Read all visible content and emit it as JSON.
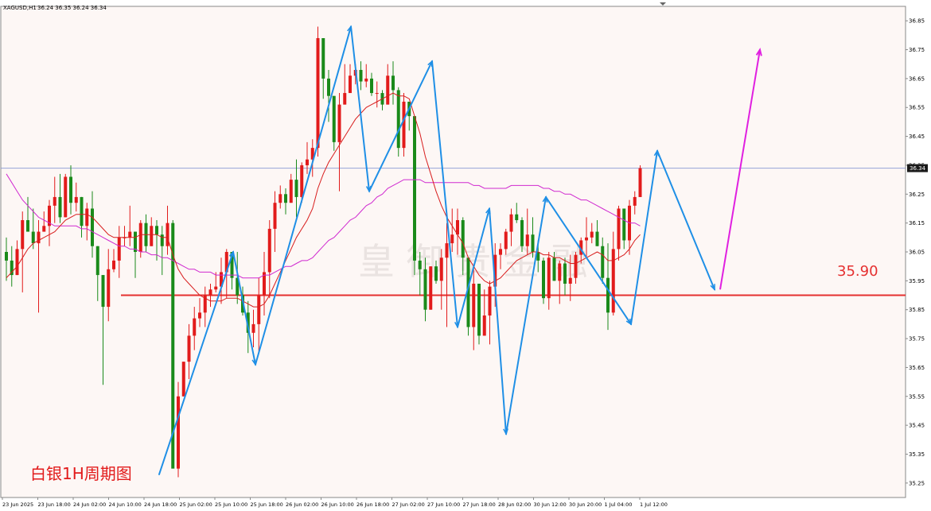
{
  "header": {
    "symbol": "XAGUSD,H1",
    "ohlc": "36.24 36.35 36.24 36.34"
  },
  "price_badge": "36.34",
  "level_label": "35.90",
  "chart_caption": "白银1H周期图",
  "watermark": "皇 御 贵 金 融",
  "colors": {
    "background": "#fdf7f5",
    "bull_candle": "#e21b1b",
    "bear_candle": "#1a8a1a",
    "ma_fast": "#d81e1e",
    "ma_slow": "#d02ad0",
    "wave_lines": "#1f8fe6",
    "projection": "#e020e0",
    "support_line": "#e53030",
    "current_price_line": "#7a8fd0"
  },
  "chart_data": {
    "type": "candlestick",
    "symbol": "XAGUSD",
    "timeframe": "H1",
    "title": "白银1H周期图",
    "ylim": [
      35.2,
      36.9
    ],
    "y_ticks": [
      35.25,
      35.35,
      35.45,
      35.55,
      35.65,
      35.75,
      35.85,
      35.95,
      36.05,
      36.15,
      36.25,
      36.35,
      36.45,
      36.55,
      36.65,
      36.75,
      36.85
    ],
    "x_ticks": [
      "23 Jun 2025",
      "23 Jun 18:00",
      "24 Jun 02:00",
      "24 Jun 10:00",
      "24 Jun 18:00",
      "25 Jun 02:00",
      "25 Jun 10:00",
      "25 Jun 18:00",
      "26 Jun 02:00",
      "26 Jun 10:00",
      "26 Jun 18:00",
      "27 Jun 02:00",
      "27 Jun 10:00",
      "27 Jun 18:00",
      "28 Jun 02:00",
      "30 Jun 12:00",
      "30 Jun 20:00",
      "1 Jul 04:00",
      "1 Jul 12:00"
    ],
    "current_price": 36.34,
    "support_level": 35.9,
    "wave_points": [
      35.28,
      36.05,
      35.66,
      36.83,
      36.26,
      36.71,
      35.79,
      36.2,
      35.42,
      36.24,
      35.8,
      36.4,
      35.92
    ],
    "projection_points": [
      35.92,
      36.75
    ],
    "series": [
      {
        "name": "OHLC",
        "points": [
          [
            36.05,
            36.1,
            35.95,
            36.02
          ],
          [
            36.02,
            36.07,
            35.93,
            35.97
          ],
          [
            35.97,
            36.09,
            35.97,
            36.06
          ],
          [
            36.06,
            36.19,
            35.91,
            36.16
          ],
          [
            36.16,
            36.24,
            36.12,
            36.12
          ],
          [
            36.12,
            36.2,
            36.06,
            36.08
          ],
          [
            36.08,
            36.16,
            35.84,
            36.12
          ],
          [
            36.12,
            36.19,
            36.12,
            36.14
          ],
          [
            36.14,
            36.23,
            36.07,
            36.21
          ],
          [
            36.21,
            36.31,
            36.15,
            36.24
          ],
          [
            36.24,
            36.32,
            36.15,
            36.17
          ],
          [
            36.17,
            36.32,
            36.17,
            36.31
          ],
          [
            36.31,
            36.35,
            36.18,
            36.22
          ],
          [
            36.22,
            36.29,
            36.19,
            36.24
          ],
          [
            36.24,
            36.24,
            36.1,
            36.14
          ],
          [
            36.14,
            36.22,
            36.09,
            36.2
          ],
          [
            36.2,
            36.26,
            36.03,
            36.07
          ],
          [
            36.07,
            36.07,
            35.88,
            35.97
          ],
          [
            35.97,
            35.97,
            35.59,
            35.86
          ],
          [
            35.86,
            36.06,
            35.81,
            35.99
          ],
          [
            35.99,
            36.06,
            35.98,
            36.02
          ],
          [
            36.02,
            36.14,
            35.96,
            36.1
          ],
          [
            36.1,
            36.14,
            36.07,
            36.1
          ],
          [
            36.1,
            36.21,
            36.07,
            36.12
          ],
          [
            36.12,
            36.12,
            35.96,
            36.05
          ],
          [
            36.05,
            36.16,
            36.03,
            36.15
          ],
          [
            36.15,
            36.18,
            36.05,
            36.07
          ],
          [
            36.07,
            36.17,
            36.07,
            36.14
          ],
          [
            36.14,
            36.16,
            36.02,
            36.11
          ],
          [
            36.11,
            36.14,
            35.97,
            36.07
          ],
          [
            36.07,
            36.21,
            36.04,
            36.15
          ],
          [
            36.15,
            36.16,
            35.59,
            35.3
          ],
          [
            35.3,
            35.6,
            35.27,
            35.55
          ],
          [
            35.55,
            35.67,
            35.55,
            35.67
          ],
          [
            35.67,
            35.8,
            35.61,
            35.76
          ],
          [
            35.76,
            35.86,
            35.71,
            35.82
          ],
          [
            35.82,
            35.89,
            35.79,
            35.84
          ],
          [
            35.84,
            35.93,
            35.79,
            35.9
          ],
          [
            35.9,
            35.94,
            35.86,
            35.92
          ],
          [
            35.92,
            35.98,
            35.91,
            35.93
          ],
          [
            35.93,
            36.03,
            35.87,
            35.98
          ],
          [
            35.98,
            36.06,
            35.89,
            36.05
          ],
          [
            36.05,
            36.05,
            35.92,
            35.96
          ],
          [
            35.96,
            36.05,
            35.87,
            35.9
          ],
          [
            35.9,
            35.93,
            35.83,
            35.84
          ],
          [
            35.84,
            35.88,
            35.7,
            35.77
          ],
          [
            35.77,
            35.85,
            35.72,
            35.8
          ],
          [
            35.8,
            35.96,
            35.7,
            35.9
          ],
          [
            35.9,
            36.05,
            35.83,
            35.98
          ],
          [
            35.98,
            36.16,
            35.89,
            36.13
          ],
          [
            36.13,
            36.26,
            36.05,
            36.22
          ],
          [
            36.22,
            36.28,
            36.2,
            36.25
          ],
          [
            36.25,
            36.27,
            36.18,
            36.22
          ],
          [
            36.22,
            36.32,
            36.22,
            36.3
          ],
          [
            36.3,
            36.37,
            36.17,
            36.24
          ],
          [
            36.24,
            36.36,
            36.22,
            36.35
          ],
          [
            36.35,
            36.43,
            36.32,
            36.37
          ],
          [
            36.37,
            36.44,
            36.31,
            36.41
          ],
          [
            36.41,
            36.83,
            36.38,
            36.79
          ],
          [
            36.79,
            36.79,
            36.58,
            36.65
          ],
          [
            36.65,
            36.68,
            36.5,
            36.59
          ],
          [
            36.59,
            36.59,
            36.4,
            36.43
          ],
          [
            36.43,
            36.6,
            36.26,
            36.56
          ],
          [
            36.56,
            36.7,
            36.56,
            36.6
          ],
          [
            36.6,
            36.7,
            36.6,
            36.66
          ],
          [
            36.66,
            36.7,
            36.63,
            36.68
          ],
          [
            36.68,
            36.71,
            36.61,
            36.64
          ],
          [
            36.64,
            36.7,
            36.62,
            36.65
          ],
          [
            36.65,
            36.67,
            36.59,
            36.6
          ],
          [
            36.6,
            36.64,
            36.55,
            36.6
          ],
          [
            36.6,
            36.61,
            36.54,
            36.56
          ],
          [
            36.56,
            36.7,
            36.56,
            36.66
          ],
          [
            36.66,
            36.71,
            36.56,
            36.61
          ],
          [
            36.61,
            36.62,
            36.38,
            36.41
          ],
          [
            36.41,
            36.6,
            36.38,
            36.57
          ],
          [
            36.57,
            36.57,
            36.47,
            36.52
          ],
          [
            36.52,
            36.52,
            35.97,
            36.02
          ],
          [
            36.02,
            36.05,
            35.9,
            35.99
          ],
          [
            35.99,
            36.03,
            35.81,
            35.85
          ],
          [
            35.85,
            36.0,
            35.85,
            36.0
          ],
          [
            36.0,
            36.02,
            35.94,
            35.95
          ],
          [
            35.95,
            36.06,
            35.85,
            36.03
          ],
          [
            36.03,
            36.15,
            35.79,
            36.08
          ],
          [
            36.08,
            36.2,
            36.05,
            36.11
          ],
          [
            36.11,
            36.2,
            36.04,
            36.16
          ],
          [
            36.16,
            36.17,
            35.97,
            36.03
          ],
          [
            36.03,
            36.03,
            35.76,
            35.79
          ],
          [
            35.79,
            35.99,
            35.71,
            35.94
          ],
          [
            35.94,
            35.94,
            35.73,
            35.76
          ],
          [
            35.76,
            35.92,
            35.76,
            35.83
          ],
          [
            35.83,
            35.95,
            35.73,
            35.93
          ],
          [
            35.93,
            36.08,
            35.86,
            36.04
          ],
          [
            36.04,
            36.08,
            35.99,
            36.06
          ],
          [
            36.06,
            36.13,
            36.04,
            36.12
          ],
          [
            36.12,
            36.2,
            36.07,
            36.18
          ],
          [
            36.18,
            36.22,
            36.15,
            36.16
          ],
          [
            36.16,
            36.17,
            36.05,
            36.07
          ],
          [
            36.07,
            36.2,
            36.04,
            36.11
          ],
          [
            36.11,
            36.17,
            36.03,
            36.05
          ],
          [
            36.05,
            36.09,
            35.98,
            36.02
          ],
          [
            36.02,
            36.03,
            35.87,
            35.89
          ],
          [
            35.89,
            36.05,
            35.85,
            36.03
          ],
          [
            36.03,
            36.05,
            35.95,
            35.95
          ],
          [
            35.95,
            36.02,
            35.87,
            36.01
          ],
          [
            36.01,
            36.03,
            35.9,
            35.94
          ],
          [
            35.94,
            36.04,
            35.88,
            35.96
          ],
          [
            35.96,
            36.05,
            35.94,
            36.04
          ],
          [
            36.04,
            36.1,
            36.01,
            36.09
          ],
          [
            36.09,
            36.17,
            36.03,
            36.1
          ],
          [
            36.1,
            36.15,
            36.08,
            36.12
          ],
          [
            36.12,
            36.16,
            36.07,
            36.07
          ],
          [
            36.07,
            36.1,
            35.94,
            35.96
          ],
          [
            35.96,
            36.08,
            35.78,
            35.84
          ],
          [
            35.84,
            36.12,
            35.83,
            36.06
          ],
          [
            36.06,
            36.21,
            36.02,
            36.2
          ],
          [
            36.2,
            36.2,
            36.06,
            36.09
          ],
          [
            36.09,
            36.23,
            36.04,
            36.21
          ],
          [
            36.21,
            36.26,
            36.18,
            36.24
          ],
          [
            36.24,
            36.35,
            36.24,
            36.34
          ]
        ]
      },
      {
        "name": "MA fast",
        "values": [
          35.96,
          35.98,
          36.0,
          36.03,
          36.06,
          36.08,
          36.09,
          36.1,
          36.11,
          36.12,
          36.14,
          36.16,
          36.17,
          36.18,
          36.18,
          36.18,
          36.17,
          36.15,
          36.13,
          36.11,
          36.1,
          36.1,
          36.1,
          36.1,
          36.1,
          36.11,
          36.11,
          36.11,
          36.11,
          36.1,
          36.1,
          36.04,
          35.99,
          35.96,
          35.94,
          35.92,
          35.9,
          35.89,
          35.88,
          35.88,
          35.88,
          35.89,
          35.89,
          35.89,
          35.88,
          35.87,
          35.86,
          35.86,
          35.87,
          35.9,
          35.94,
          35.98,
          36.02,
          36.06,
          36.1,
          36.13,
          36.16,
          36.2,
          36.27,
          36.32,
          36.36,
          36.39,
          36.42,
          36.45,
          36.48,
          36.51,
          36.53,
          36.55,
          36.56,
          36.57,
          36.58,
          36.59,
          36.6,
          36.59,
          36.59,
          36.58,
          36.52,
          36.46,
          36.38,
          36.32,
          36.26,
          36.21,
          36.17,
          36.14,
          36.11,
          36.08,
          36.03,
          36.0,
          35.97,
          35.95,
          35.94,
          35.95,
          35.96,
          35.98,
          36.0,
          36.02,
          36.03,
          36.04,
          36.05,
          36.05,
          36.04,
          36.04,
          36.03,
          36.03,
          36.02,
          36.01,
          36.01,
          36.02,
          36.03,
          36.04,
          36.05,
          36.04,
          36.02,
          36.02,
          36.03,
          36.04,
          36.06,
          36.09,
          36.11
        ]
      },
      {
        "name": "MA slow",
        "values": [
          36.32,
          36.29,
          36.26,
          36.23,
          36.21,
          36.19,
          36.17,
          36.16,
          36.15,
          36.14,
          36.14,
          36.14,
          36.14,
          36.14,
          36.13,
          36.13,
          36.12,
          36.11,
          36.1,
          36.09,
          36.08,
          36.07,
          36.07,
          36.06,
          36.06,
          36.05,
          36.05,
          36.04,
          36.04,
          36.03,
          36.03,
          36.02,
          36.01,
          36.0,
          35.99,
          35.99,
          35.98,
          35.98,
          35.98,
          35.97,
          35.97,
          35.97,
          35.97,
          35.97,
          35.96,
          35.96,
          35.96,
          35.96,
          35.97,
          35.97,
          35.98,
          35.99,
          36.0,
          36.0,
          36.01,
          36.02,
          36.02,
          36.03,
          36.05,
          36.07,
          36.09,
          36.1,
          36.12,
          36.14,
          36.16,
          36.17,
          36.19,
          36.21,
          36.22,
          36.24,
          36.25,
          36.27,
          36.28,
          36.29,
          36.3,
          36.3,
          36.3,
          36.3,
          36.29,
          36.29,
          36.29,
          36.29,
          36.29,
          36.29,
          36.29,
          36.29,
          36.29,
          36.28,
          36.28,
          36.27,
          36.27,
          36.27,
          36.27,
          36.27,
          36.28,
          36.28,
          36.28,
          36.28,
          36.28,
          36.28,
          36.27,
          36.27,
          36.26,
          36.26,
          36.25,
          36.25,
          36.24,
          36.23,
          36.23,
          36.22,
          36.21,
          36.2,
          36.19,
          36.18,
          36.17,
          36.16,
          36.15,
          36.15,
          36.14
        ]
      }
    ]
  }
}
